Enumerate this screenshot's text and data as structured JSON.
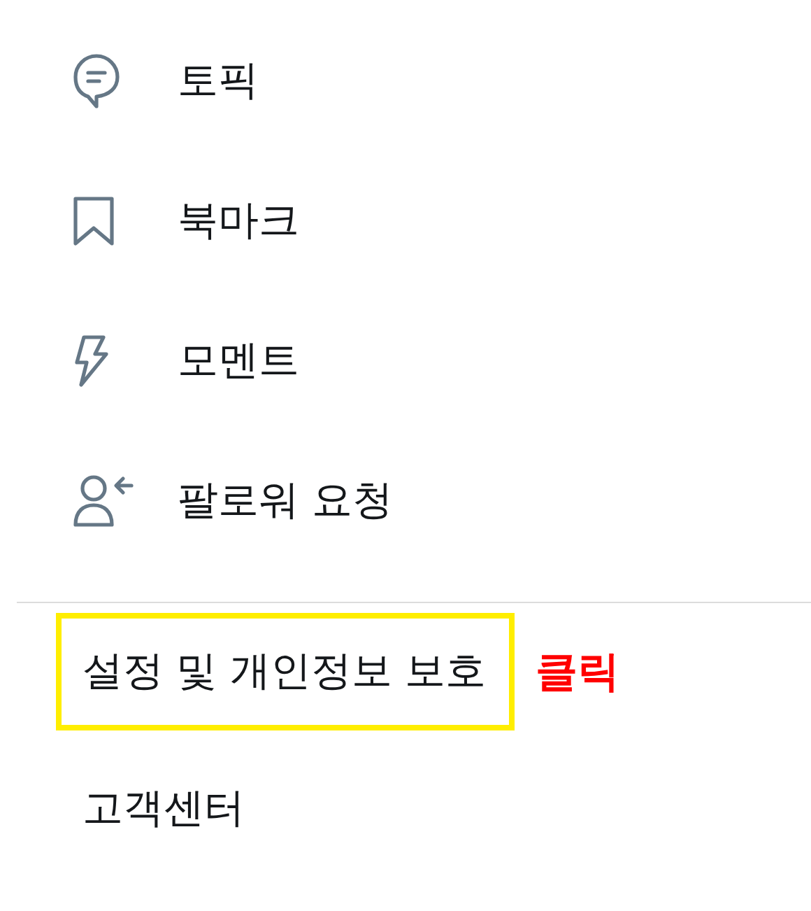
{
  "menu_items": [
    {
      "kind": "topic",
      "label": "토픽"
    },
    {
      "kind": "bookmark",
      "label": "북마크"
    },
    {
      "kind": "moment",
      "label": "모멘트"
    },
    {
      "kind": "follow",
      "label": "팔로워 요청"
    }
  ],
  "settings_items": [
    {
      "label": "설정 및 개인정보 보호",
      "highlighted": true,
      "annotation": "클릭"
    },
    {
      "label": "고객센터",
      "highlighted": false
    }
  ]
}
